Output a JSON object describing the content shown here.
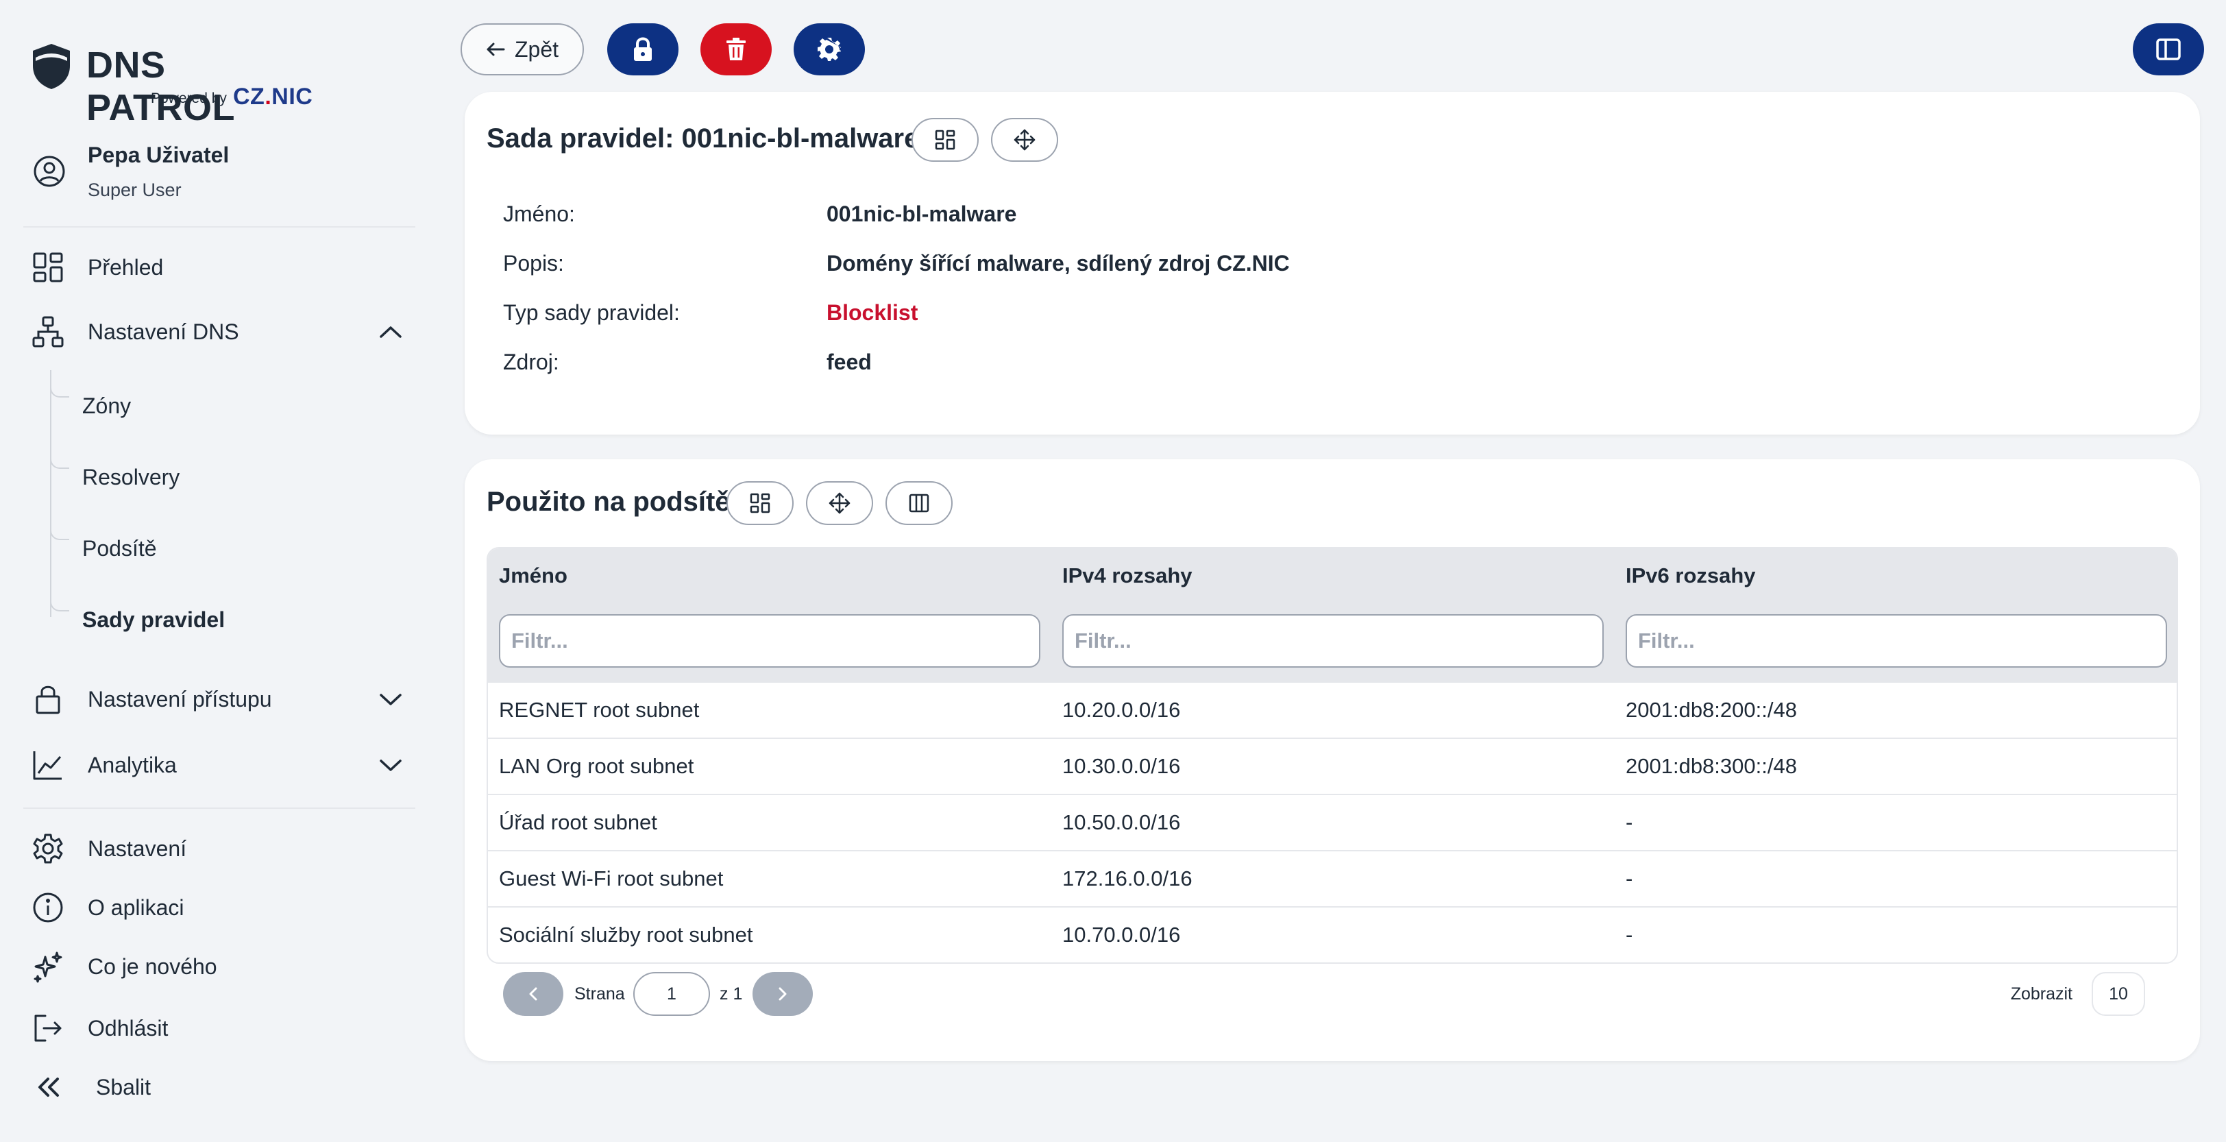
{
  "brand": {
    "name": "DNS PATROL",
    "powered_by": "Powered by",
    "partner_prefix": "CZ",
    "partner_dot": ".",
    "partner_suffix": "NIC"
  },
  "user": {
    "name": "Pepa Uživatel",
    "role": "Super User"
  },
  "nav": {
    "overview": "Přehled",
    "dns_settings": "Nastavení DNS",
    "dns_sub": [
      "Zóny",
      "Resolvery",
      "Podsítě",
      "Sady pravidel"
    ],
    "access_settings": "Nastavení přístupu",
    "analytics": "Analytika",
    "settings": "Nastavení",
    "about": "O aplikaci",
    "whats_new": "Co je nového",
    "logout": "Odhlásit",
    "collapse": "Sbalit"
  },
  "toolbar": {
    "back_label": "Zpět"
  },
  "ruleset": {
    "title": "Sada pravidel: 001nic-bl-malware",
    "fields": [
      {
        "label": "Jméno:",
        "value": "001nic-bl-malware"
      },
      {
        "label": "Popis:",
        "value": "Domény šířící malware, sdílený zdroj CZ.NIC"
      },
      {
        "label": "Typ sady pravidel:",
        "value": "Blocklist"
      },
      {
        "label": "Zdroj:",
        "value": "feed"
      }
    ]
  },
  "subnets": {
    "title": "Použito na podsítě",
    "columns": [
      "Jméno",
      "IPv4 rozsahy",
      "IPv6 rozsahy"
    ],
    "filter_placeholder": "Filtr...",
    "rows": [
      [
        "REGNET root subnet",
        "10.20.0.0/16",
        "2001:db8:200::/48"
      ],
      [
        "LAN Org root subnet",
        "10.30.0.0/16",
        "2001:db8:300::/48"
      ],
      [
        "Úřad root subnet",
        "10.50.0.0/16",
        "-"
      ],
      [
        "Guest Wi-Fi root subnet",
        "172.16.0.0/16",
        "-"
      ],
      [
        "Sociální služby root subnet",
        "10.70.0.0/16",
        "-"
      ]
    ],
    "pager": {
      "page_label": "Strana",
      "page": "1",
      "of_label": "z 1",
      "show_label": "Zobrazit",
      "page_size": "10"
    }
  },
  "colors": {
    "navy": "#0d3183",
    "danger": "#d7121f",
    "blocklist": "#c8102e"
  }
}
